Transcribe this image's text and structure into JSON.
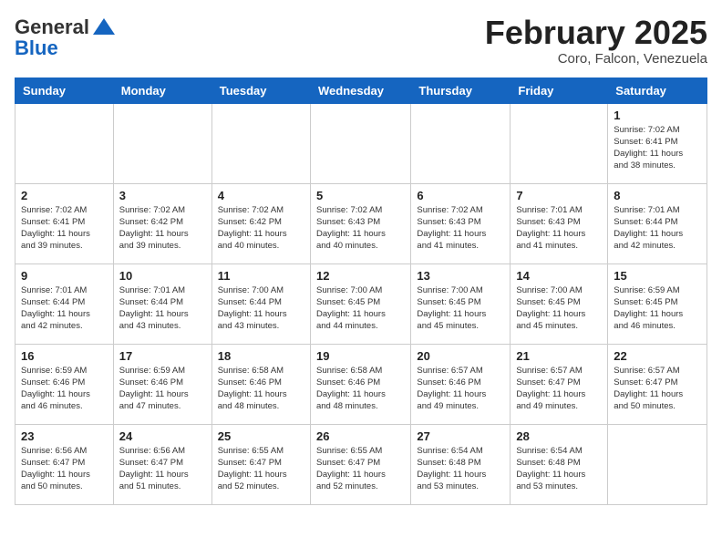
{
  "header": {
    "logo_general": "General",
    "logo_blue": "Blue",
    "month_title": "February 2025",
    "location": "Coro, Falcon, Venezuela"
  },
  "weekdays": [
    "Sunday",
    "Monday",
    "Tuesday",
    "Wednesday",
    "Thursday",
    "Friday",
    "Saturday"
  ],
  "weeks": [
    [
      {
        "day": "",
        "info": ""
      },
      {
        "day": "",
        "info": ""
      },
      {
        "day": "",
        "info": ""
      },
      {
        "day": "",
        "info": ""
      },
      {
        "day": "",
        "info": ""
      },
      {
        "day": "",
        "info": ""
      },
      {
        "day": "1",
        "info": "Sunrise: 7:02 AM\nSunset: 6:41 PM\nDaylight: 11 hours\nand 38 minutes."
      }
    ],
    [
      {
        "day": "2",
        "info": "Sunrise: 7:02 AM\nSunset: 6:41 PM\nDaylight: 11 hours\nand 39 minutes."
      },
      {
        "day": "3",
        "info": "Sunrise: 7:02 AM\nSunset: 6:42 PM\nDaylight: 11 hours\nand 39 minutes."
      },
      {
        "day": "4",
        "info": "Sunrise: 7:02 AM\nSunset: 6:42 PM\nDaylight: 11 hours\nand 40 minutes."
      },
      {
        "day": "5",
        "info": "Sunrise: 7:02 AM\nSunset: 6:43 PM\nDaylight: 11 hours\nand 40 minutes."
      },
      {
        "day": "6",
        "info": "Sunrise: 7:02 AM\nSunset: 6:43 PM\nDaylight: 11 hours\nand 41 minutes."
      },
      {
        "day": "7",
        "info": "Sunrise: 7:01 AM\nSunset: 6:43 PM\nDaylight: 11 hours\nand 41 minutes."
      },
      {
        "day": "8",
        "info": "Sunrise: 7:01 AM\nSunset: 6:44 PM\nDaylight: 11 hours\nand 42 minutes."
      }
    ],
    [
      {
        "day": "9",
        "info": "Sunrise: 7:01 AM\nSunset: 6:44 PM\nDaylight: 11 hours\nand 42 minutes."
      },
      {
        "day": "10",
        "info": "Sunrise: 7:01 AM\nSunset: 6:44 PM\nDaylight: 11 hours\nand 43 minutes."
      },
      {
        "day": "11",
        "info": "Sunrise: 7:00 AM\nSunset: 6:44 PM\nDaylight: 11 hours\nand 43 minutes."
      },
      {
        "day": "12",
        "info": "Sunrise: 7:00 AM\nSunset: 6:45 PM\nDaylight: 11 hours\nand 44 minutes."
      },
      {
        "day": "13",
        "info": "Sunrise: 7:00 AM\nSunset: 6:45 PM\nDaylight: 11 hours\nand 45 minutes."
      },
      {
        "day": "14",
        "info": "Sunrise: 7:00 AM\nSunset: 6:45 PM\nDaylight: 11 hours\nand 45 minutes."
      },
      {
        "day": "15",
        "info": "Sunrise: 6:59 AM\nSunset: 6:45 PM\nDaylight: 11 hours\nand 46 minutes."
      }
    ],
    [
      {
        "day": "16",
        "info": "Sunrise: 6:59 AM\nSunset: 6:46 PM\nDaylight: 11 hours\nand 46 minutes."
      },
      {
        "day": "17",
        "info": "Sunrise: 6:59 AM\nSunset: 6:46 PM\nDaylight: 11 hours\nand 47 minutes."
      },
      {
        "day": "18",
        "info": "Sunrise: 6:58 AM\nSunset: 6:46 PM\nDaylight: 11 hours\nand 48 minutes."
      },
      {
        "day": "19",
        "info": "Sunrise: 6:58 AM\nSunset: 6:46 PM\nDaylight: 11 hours\nand 48 minutes."
      },
      {
        "day": "20",
        "info": "Sunrise: 6:57 AM\nSunset: 6:46 PM\nDaylight: 11 hours\nand 49 minutes."
      },
      {
        "day": "21",
        "info": "Sunrise: 6:57 AM\nSunset: 6:47 PM\nDaylight: 11 hours\nand 49 minutes."
      },
      {
        "day": "22",
        "info": "Sunrise: 6:57 AM\nSunset: 6:47 PM\nDaylight: 11 hours\nand 50 minutes."
      }
    ],
    [
      {
        "day": "23",
        "info": "Sunrise: 6:56 AM\nSunset: 6:47 PM\nDaylight: 11 hours\nand 50 minutes."
      },
      {
        "day": "24",
        "info": "Sunrise: 6:56 AM\nSunset: 6:47 PM\nDaylight: 11 hours\nand 51 minutes."
      },
      {
        "day": "25",
        "info": "Sunrise: 6:55 AM\nSunset: 6:47 PM\nDaylight: 11 hours\nand 52 minutes."
      },
      {
        "day": "26",
        "info": "Sunrise: 6:55 AM\nSunset: 6:47 PM\nDaylight: 11 hours\nand 52 minutes."
      },
      {
        "day": "27",
        "info": "Sunrise: 6:54 AM\nSunset: 6:48 PM\nDaylight: 11 hours\nand 53 minutes."
      },
      {
        "day": "28",
        "info": "Sunrise: 6:54 AM\nSunset: 6:48 PM\nDaylight: 11 hours\nand 53 minutes."
      },
      {
        "day": "",
        "info": ""
      }
    ]
  ]
}
